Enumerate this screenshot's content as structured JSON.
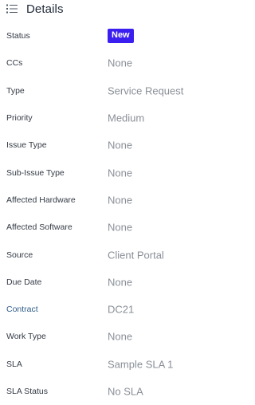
{
  "header": {
    "title": "Details",
    "icon": "list-icon"
  },
  "colors": {
    "badge_bg": "#3b1ef0",
    "link": "#2f5d8a",
    "value": "#8a8f97",
    "label": "#333a44"
  },
  "fields": [
    {
      "label": "Status",
      "value": "New",
      "badge": true
    },
    {
      "label": "CCs",
      "value": "None"
    },
    {
      "label": "Type",
      "value": "Service Request"
    },
    {
      "label": "Priority",
      "value": "Medium"
    },
    {
      "label": "Issue Type",
      "value": "None"
    },
    {
      "label": "Sub-Issue Type",
      "value": "None"
    },
    {
      "label": "Affected Hardware",
      "value": "None"
    },
    {
      "label": "Affected Software",
      "value": "None"
    },
    {
      "label": "Source",
      "value": "Client Portal"
    },
    {
      "label": "Due Date",
      "value": "None"
    },
    {
      "label": "Contract",
      "value": "DC21",
      "link": true
    },
    {
      "label": "Work Type",
      "value": "None"
    },
    {
      "label": "SLA",
      "value": "Sample SLA 1"
    },
    {
      "label": "SLA Status",
      "value": "No SLA"
    }
  ]
}
